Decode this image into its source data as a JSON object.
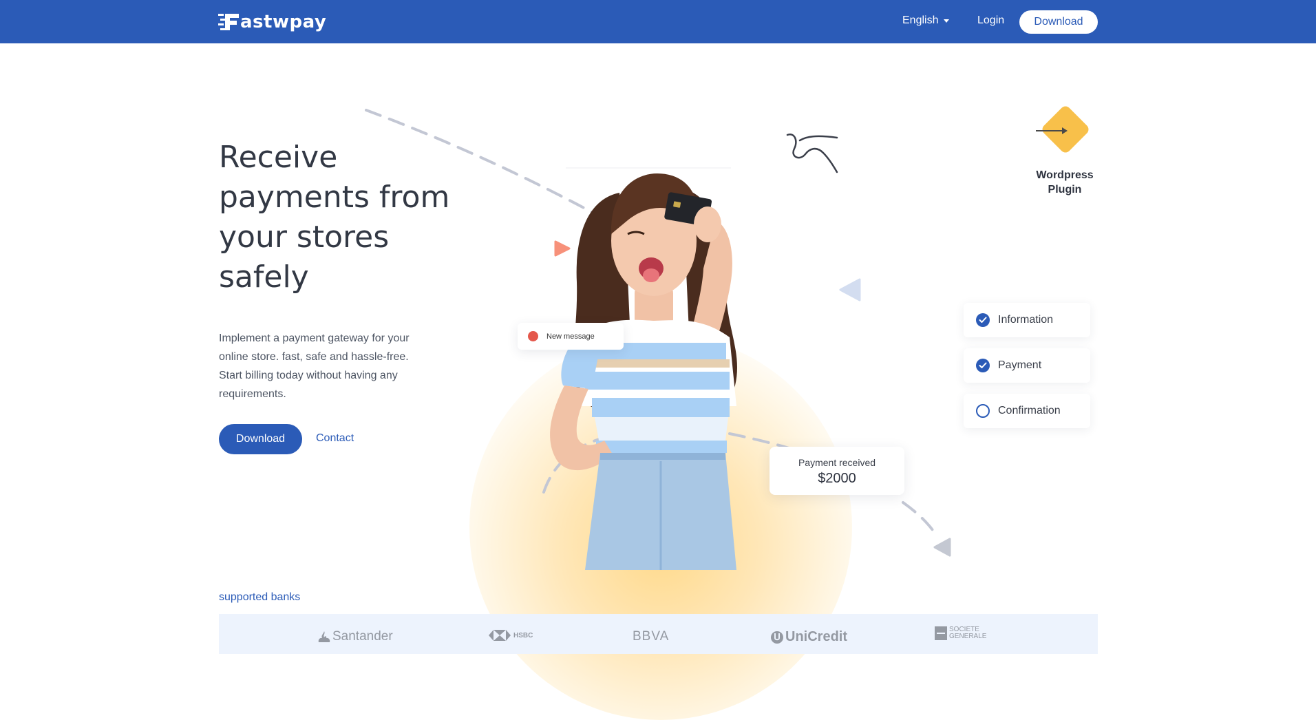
{
  "header": {
    "logo_text": "astwpay",
    "language": "English",
    "login": "Login",
    "download": "Download"
  },
  "hero": {
    "title": "Receive payments from your stores safely",
    "description": "Implement a payment gateway for your online store. fast, safe and hassle-free. Start billing today without having any requirements.",
    "primary_button": "Download",
    "secondary_link": "Contact"
  },
  "notifications": {
    "message": "New message",
    "payment_label": "Payment received",
    "payment_amount": "$2000"
  },
  "steps": [
    {
      "label": "Information",
      "status": "done"
    },
    {
      "label": "Payment",
      "status": "done"
    },
    {
      "label": "Confirmation",
      "status": "pending"
    }
  ],
  "plugin": {
    "label": "Wordpress Plugin"
  },
  "banks": {
    "title": "supported banks",
    "items": [
      "Santander",
      "HSBC",
      "BBVA",
      "UniCredit",
      "SOCIETE GENERALE"
    ]
  },
  "colors": {
    "brand": "#2b5bb7",
    "accent_yellow": "#f8c04a",
    "alert_red": "#e4574b",
    "bank_strip": "#edf3fd"
  },
  "icons": [
    "logo-mark-icon",
    "caret-down-icon",
    "play-icon",
    "triangle-left-icon",
    "squiggle-icon",
    "check-icon",
    "circle-icon",
    "arrow-right-icon",
    "santander-flame-icon",
    "hsbc-hexagon-icon",
    "unicredit-icon",
    "societe-generale-icon"
  ]
}
